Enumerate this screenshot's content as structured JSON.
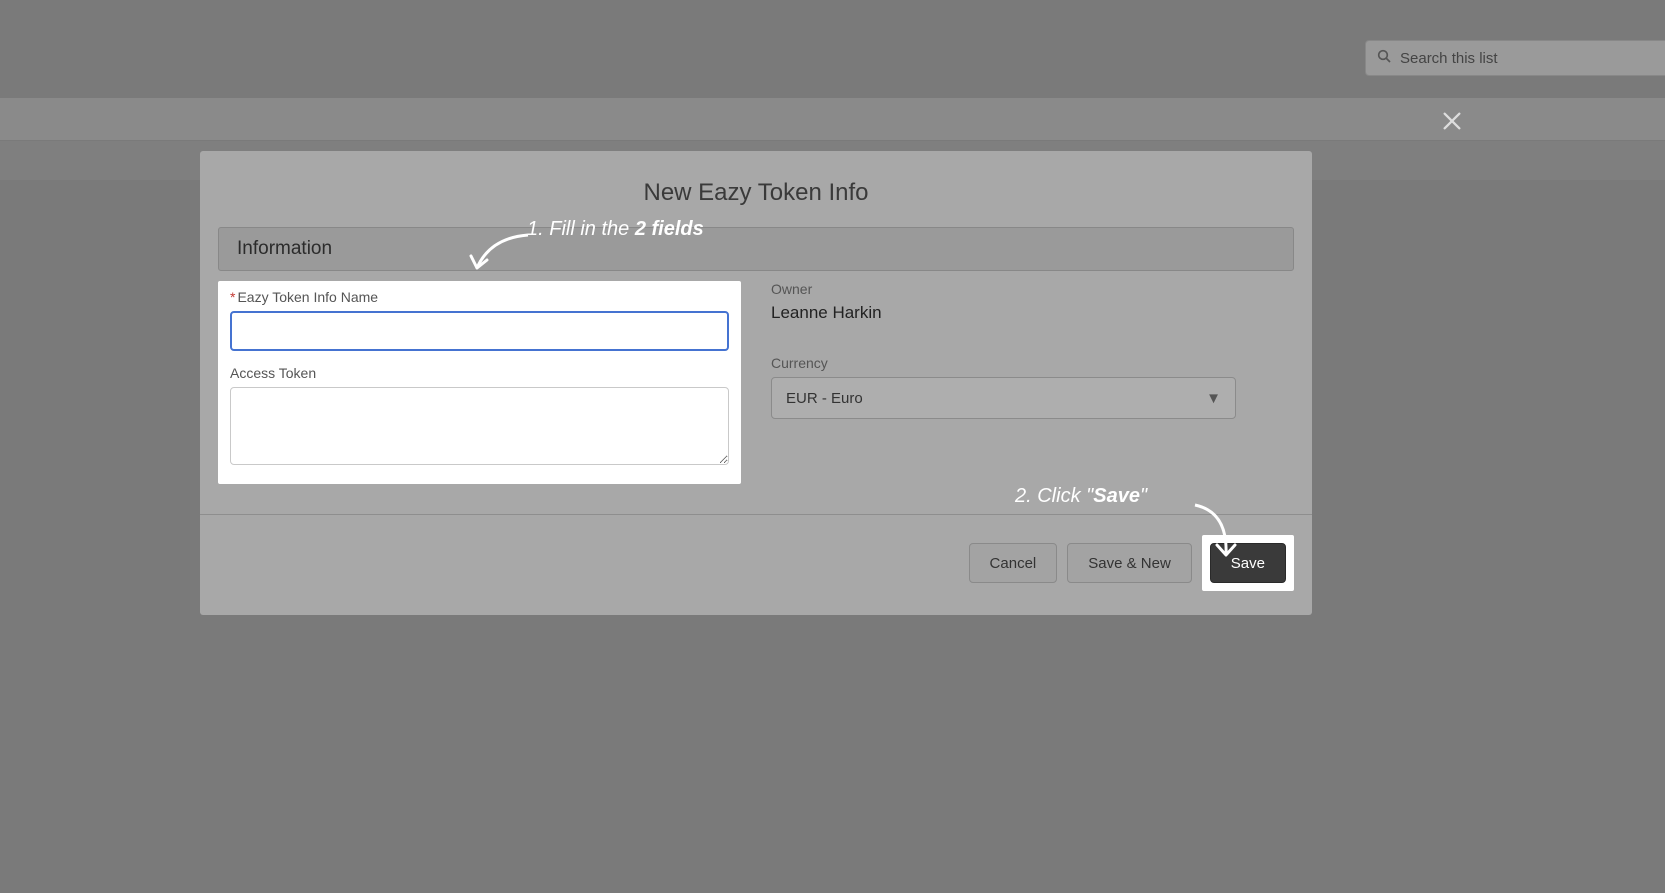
{
  "search": {
    "placeholder": "Search this list"
  },
  "modal": {
    "title": "New Eazy Token Info",
    "section": "Information",
    "fields": {
      "name_label": "Eazy Token Info Name",
      "name_value": "",
      "access_token_label": "Access Token",
      "access_token_value": "",
      "owner_label": "Owner",
      "owner_value": "Leanne Harkin",
      "currency_label": "Currency",
      "currency_value": "EUR - Euro"
    },
    "buttons": {
      "cancel": "Cancel",
      "save_new": "Save & New",
      "save": "Save"
    }
  },
  "annotations": {
    "step1_pre": "1. Fill in the ",
    "step1_bold": "2 fields",
    "step2_pre": "2. Click \"",
    "step2_bold": "Save",
    "step2_post": "\""
  }
}
